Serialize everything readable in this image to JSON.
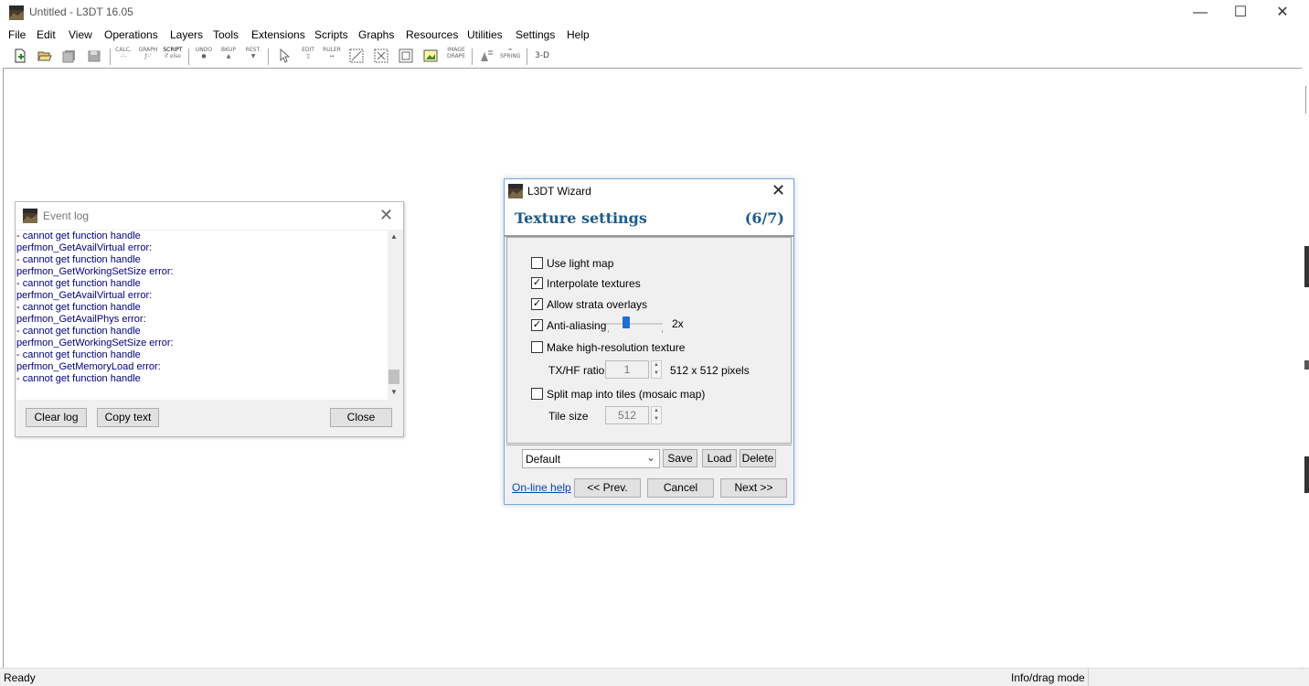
{
  "window": {
    "title": "Untitled - L3DT 16.05"
  },
  "menu": [
    "File",
    "Edit",
    "View",
    "Operations",
    "Layers",
    "Tools",
    "Extensions",
    "Scripts",
    "Graphs",
    "Resources",
    "Utilities",
    "Settings",
    "Help"
  ],
  "toolbar": {
    "calc": [
      "CALC.",
      "-'-"
    ],
    "graph": [
      "GRAPH",
      "J'-'"
    ],
    "script": [
      "SCRIPT",
      "if else"
    ],
    "undo": "UNDO",
    "bkup": "BKUP",
    "rest": "REST.",
    "edit": "EDIT",
    "ruler": "RULER",
    "image": [
      "IMAGE",
      "DRAPE"
    ],
    "spring": "SPRING",
    "threed": "3-D"
  },
  "status": {
    "left": "Ready",
    "right": "Info/drag mode"
  },
  "eventlog": {
    "title": "Event log",
    "lines": [
      " - cannot get function handle",
      "perfmon_GetAvailVirtual error:",
      " - cannot get function handle",
      "perfmon_GetWorkingSetSize error:",
      " - cannot get function handle",
      "perfmon_GetAvailVirtual error:",
      " - cannot get function handle",
      "perfmon_GetAvailPhys error:",
      " - cannot get function handle",
      "perfmon_GetWorkingSetSize error:",
      " - cannot get function handle",
      "perfmon_GetMemoryLoad error:",
      " - cannot get function handle"
    ],
    "buttons": {
      "clear": "Clear log",
      "copy": "Copy text",
      "close": "Close"
    }
  },
  "wizard": {
    "title": "L3DT Wizard",
    "heading": "Texture settings",
    "step": "(6/7)",
    "options": {
      "use_light_map": {
        "label": "Use light map",
        "checked": false
      },
      "interpolate": {
        "label": "Interpolate textures",
        "checked": true
      },
      "strata": {
        "label": "Allow strata overlays",
        "checked": true
      },
      "antialias": {
        "label": "Anti-aliasing",
        "checked": true,
        "value_label": "2x"
      },
      "hires": {
        "label": "Make high-resolution texture",
        "checked": false
      },
      "split": {
        "label": "Split map into tiles (mosaic map)",
        "checked": false
      }
    },
    "txhf": {
      "label": "TX/HF ratio",
      "value": "1",
      "info": "512 x 512 pixels"
    },
    "tile": {
      "label": "Tile size",
      "value": "512"
    },
    "preset": {
      "selected": "Default",
      "save": "Save",
      "load": "Load",
      "delete": "Delete"
    },
    "footer": {
      "help": "On-line help",
      "prev": "<< Prev.",
      "cancel": "Cancel",
      "next": "Next >>"
    }
  }
}
